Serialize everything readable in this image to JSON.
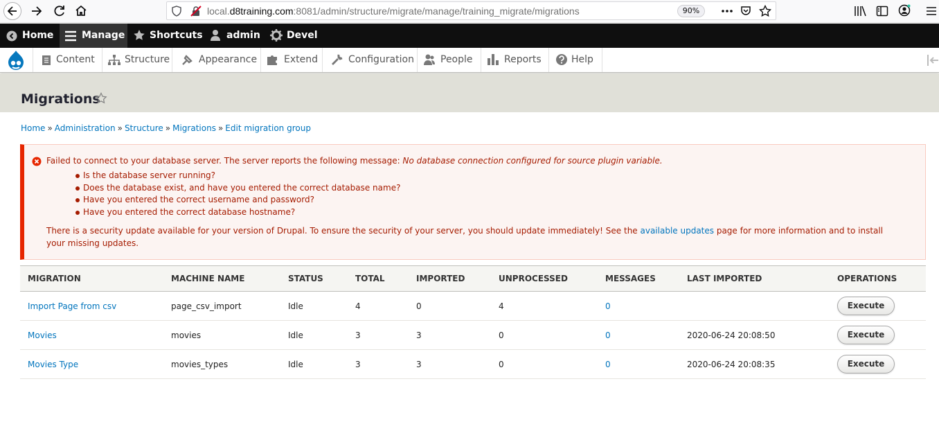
{
  "browser": {
    "url_prefix": "local.",
    "url_host": "d8training.com",
    "url_rest": ":8081/admin/structure/migrate/manage/training_migrate/migrations",
    "zoom": "90%"
  },
  "admin_bar": {
    "home": "Home",
    "manage": "Manage",
    "shortcuts": "Shortcuts",
    "user": "admin",
    "devel": "Devel"
  },
  "tray": {
    "items": [
      {
        "label": "Content",
        "icon": "content-icon"
      },
      {
        "label": "Structure",
        "icon": "structure-icon"
      },
      {
        "label": "Appearance",
        "icon": "appearance-icon"
      },
      {
        "label": "Extend",
        "icon": "extend-icon"
      },
      {
        "label": "Configuration",
        "icon": "configuration-icon"
      },
      {
        "label": "People",
        "icon": "people-icon"
      },
      {
        "label": "Reports",
        "icon": "reports-icon"
      },
      {
        "label": "Help",
        "icon": "help-icon"
      }
    ]
  },
  "page": {
    "title": "Migrations"
  },
  "breadcrumb": [
    "Home",
    "Administration",
    "Structure",
    "Migrations",
    "Edit migration group"
  ],
  "message": {
    "lead": "Failed to connect to your database server. The server reports the following message: ",
    "lead_em": "No database connection configured for source plugin variable.",
    "bullets": [
      "Is the database server running?",
      "Does the database exist, and have you entered the correct database name?",
      "Have you entered the correct username and password?",
      "Have you entered the correct database hostname?"
    ],
    "security_before": "There is a security update available for your version of Drupal. To ensure the security of your server, you should update immediately! See the ",
    "security_link": "available updates",
    "security_after": " page for more information and to install your missing updates."
  },
  "table": {
    "headers": [
      "MIGRATION",
      "MACHINE NAME",
      "STATUS",
      "TOTAL",
      "IMPORTED",
      "UNPROCESSED",
      "MESSAGES",
      "LAST IMPORTED",
      "OPERATIONS"
    ],
    "rows": [
      {
        "migration": "Import Page from csv",
        "machine": "page_csv_import",
        "status": "Idle",
        "total": "4",
        "imported": "0",
        "unprocessed": "4",
        "messages": "0",
        "last": "",
        "op": "Execute"
      },
      {
        "migration": "Movies",
        "machine": "movies",
        "status": "Idle",
        "total": "3",
        "imported": "3",
        "unprocessed": "0",
        "messages": "0",
        "last": "2020-06-24 20:08:50",
        "op": "Execute"
      },
      {
        "migration": "Movies Type",
        "machine": "movies_types",
        "status": "Idle",
        "total": "3",
        "imported": "3",
        "unprocessed": "0",
        "messages": "0",
        "last": "2020-06-24 20:08:35",
        "op": "Execute"
      }
    ]
  }
}
